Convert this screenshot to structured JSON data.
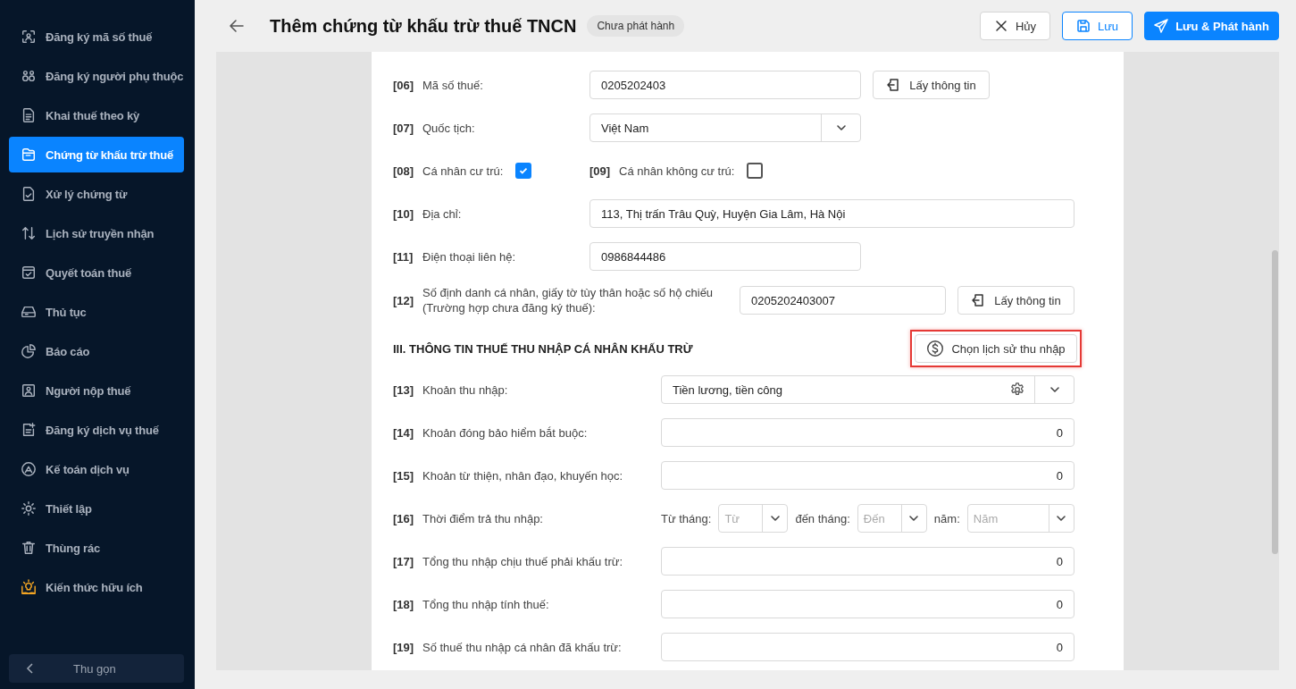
{
  "sidebar": {
    "items": [
      {
        "label": "Đăng ký mã số thuế",
        "selected": false
      },
      {
        "label": "Đăng ký người phụ thuộc",
        "selected": false
      },
      {
        "label": "Khai thuế theo kỳ",
        "selected": false
      },
      {
        "label": "Chứng từ khấu trừ thuế",
        "selected": true
      },
      {
        "label": "Xử lý chứng từ",
        "selected": false
      },
      {
        "label": "Lịch sử truyền nhận",
        "selected": false
      },
      {
        "label": "Quyết toán thuế",
        "selected": false
      },
      {
        "label": "Thủ tục",
        "selected": false
      },
      {
        "label": "Báo cáo",
        "selected": false
      },
      {
        "label": "Người nộp thuế",
        "selected": false
      },
      {
        "label": "Đăng ký dịch vụ thuế",
        "selected": false
      },
      {
        "label": "Kế toán dịch vụ",
        "selected": false
      },
      {
        "label": "Thiết lập",
        "selected": false
      },
      {
        "label": "Thùng rác",
        "selected": false
      },
      {
        "label": "Kiến thức hữu ích",
        "selected": false
      }
    ],
    "collapse": "Thu gọn"
  },
  "header": {
    "title": "Thêm chứng từ khấu trừ thuế TNCN",
    "status": "Chưa phát hành",
    "buttons": [
      {
        "kind": "cancel",
        "label": "Hủy"
      },
      {
        "kind": "save",
        "label": "Lưu"
      },
      {
        "kind": "publish",
        "label": "Lưu & Phát hành"
      }
    ]
  },
  "form": {
    "rows": [
      {
        "kind": "lookup",
        "code": "[06]",
        "label": "Mã số thuế:",
        "value": "0205202403",
        "button": "Lấy thông tin"
      },
      {
        "kind": "select",
        "code": "[07]",
        "label": "Quốc tịch:",
        "value": "Việt Nam"
      },
      {
        "kind": "checkboxes",
        "checks": [
          {
            "code": "[08]",
            "label": "Cá nhân cư trú:",
            "checked": true
          },
          {
            "code": "[09]",
            "label": "Cá nhân không cư trú:",
            "checked": false
          }
        ]
      },
      {
        "kind": "text-wide",
        "code": "[10]",
        "label": "Địa chỉ:",
        "value": "113, Thị trấn Trâu Quỳ, Huyện Gia Lâm, Hà Nội"
      },
      {
        "kind": "text",
        "code": "[11]",
        "label": "Điện thoại liên hệ:",
        "value": "0986844486"
      },
      {
        "kind": "lookup-long",
        "code": "[12]",
        "label": "Số định danh cá nhân, giấy tờ tùy thân hoặc số hộ chiếu (Trường hợp chưa đăng ký thuế):",
        "value": "0205202403007",
        "button": "Lấy thông tin"
      }
    ],
    "section": {
      "title": "III. THÔNG TIN THUẾ THU NHẬP CÁ NHÂN KHẤU TRỪ",
      "button": "Chọn lịch sử thu nhập",
      "highlighted": true
    },
    "income_rows": [
      {
        "kind": "combo",
        "code": "[13]",
        "label": "Khoản thu nhập:",
        "value": "Tiền lương, tiền công"
      },
      {
        "kind": "number",
        "code": "[14]",
        "label": "Khoản đóng bảo hiểm bắt buộc:",
        "value": "0"
      },
      {
        "kind": "number",
        "code": "[15]",
        "label": "Khoản từ thiện, nhân đạo, khuyến học:",
        "value": "0"
      },
      {
        "kind": "period",
        "code": "[16]",
        "label": "Thời điểm trả thu nhập:",
        "parts": [
          {
            "label": "Từ tháng:",
            "placeholder": "Từ"
          },
          {
            "label": "đến tháng:",
            "placeholder": "Đến"
          },
          {
            "label": "năm:",
            "placeholder": "Năm"
          }
        ]
      },
      {
        "kind": "number",
        "code": "[17]",
        "label": "Tổng thu nhập chịu thuế phải khấu trừ:",
        "value": "0"
      },
      {
        "kind": "number",
        "code": "[18]",
        "label": "Tổng thu nhập tính thuế:",
        "value": "0"
      },
      {
        "kind": "number",
        "code": "[19]",
        "label": "Số thuế thu nhập cá nhân đã khấu trừ:",
        "value": "0"
      }
    ]
  }
}
